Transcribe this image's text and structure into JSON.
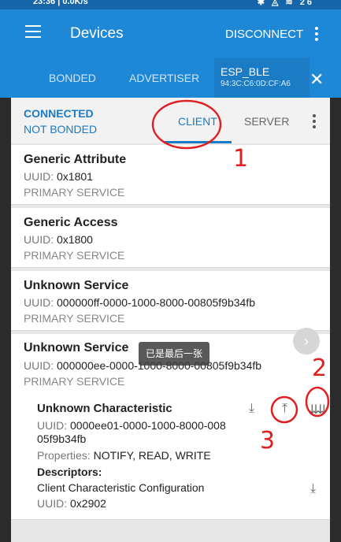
{
  "status_bar": {
    "time": "23:36 | 0.0K/s",
    "icons": "✱ ◬ ≋ 26"
  },
  "app_bar": {
    "title": "Devices",
    "disconnect": "DISCONNECT"
  },
  "tabs": {
    "bonded": "BONDED",
    "advertiser": "ADVERTISER",
    "device_name": "ESP_BLE",
    "device_mac": "94:3C:C6:0D:CF:A6"
  },
  "connection": {
    "status": "CONNECTED",
    "bond": "NOT BONDED",
    "client_tab": "CLIENT",
    "server_tab": "SERVER"
  },
  "uuid_label": "UUID:",
  "services": [
    {
      "name": "Generic Attribute",
      "uuid": "0x1801",
      "type": "PRIMARY SERVICE"
    },
    {
      "name": "Generic Access",
      "uuid": "0x1800",
      "type": "PRIMARY SERVICE"
    },
    {
      "name": "Unknown Service",
      "uuid": "000000ff-0000-1000-8000-00805f9b34fb",
      "type": "PRIMARY SERVICE"
    },
    {
      "name": "Unknown Service",
      "uuid": "000000ee-0000-1000-8000-00805f9b34fb",
      "type": "PRIMARY SERVICE"
    }
  ],
  "characteristic": {
    "name": "Unknown Characteristic",
    "uuid_line1": "0000ee01-0000-1000-8000-008",
    "uuid_line2": "05f9b34fb",
    "properties_label": "Properties:",
    "properties": "NOTIFY, READ, WRITE",
    "descriptors_label": "Descriptors:",
    "descriptor_name": "Client Characteristic Configuration",
    "descriptor_uuid": "0x2902"
  },
  "toast": "已是最后一张",
  "annotations": {
    "a1": "1",
    "a2": "2",
    "a3": "3"
  },
  "colors": {
    "primary": "#1e88d6",
    "accent_text": "#1a7bc4",
    "annotation": "#e02020"
  }
}
